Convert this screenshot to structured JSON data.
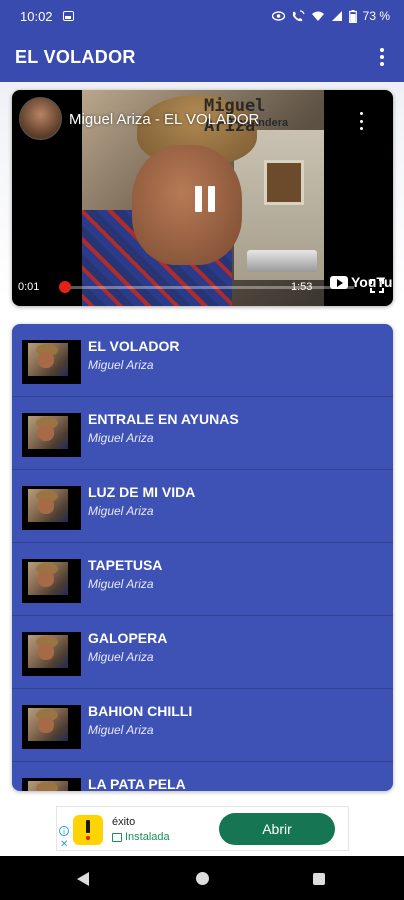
{
  "status_bar": {
    "time": "10:02",
    "battery": "73 %"
  },
  "app_bar": {
    "title": "EL VOLADOR"
  },
  "video": {
    "title": "Miguel Ariza - EL VOLADOR",
    "overlay_artist": "Miguel Ariza",
    "overlay_subtitle": "Parrandera",
    "time_current": "0:01",
    "time_total": "1:53",
    "progress_fraction": 0.01,
    "brand": "YouTube"
  },
  "playlist": {
    "items": [
      {
        "title": "EL VOLADOR",
        "artist": "Miguel Ariza"
      },
      {
        "title": "ENTRALE EN AYUNAS",
        "artist": "Miguel Ariza"
      },
      {
        "title": "LUZ DE MI VIDA",
        "artist": "Miguel Ariza"
      },
      {
        "title": "TAPETUSA",
        "artist": "Miguel Ariza"
      },
      {
        "title": "GALOPERA",
        "artist": "Miguel Ariza"
      },
      {
        "title": "BAHION CHILLI",
        "artist": "Miguel Ariza"
      },
      {
        "title": "LA PATA PELA",
        "artist": ""
      }
    ]
  },
  "ad": {
    "app_name": "éxito",
    "installed_label": "Instalada",
    "cta_label": "Abrir"
  },
  "colors": {
    "primary": "#3a4bb0",
    "playlist_bg": "#3e51b5",
    "progress": "#e62117",
    "cta": "#167553"
  }
}
